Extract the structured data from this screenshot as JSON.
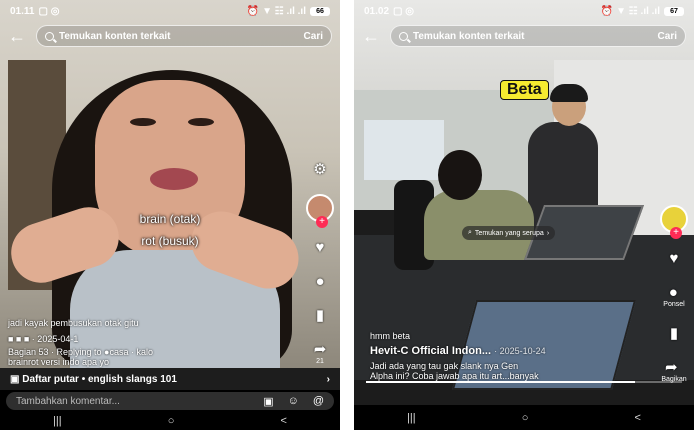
{
  "left": {
    "status_time": "01.11",
    "status_left_icons": "▢ ◎",
    "status_right_icons": "⏰ ▼ ☷ .ıl .ıl",
    "battery": "66",
    "search_placeholder": "Temukan konten terkait",
    "search_button": "Cari",
    "caption_1": "brain (otak)",
    "caption_2": "rot (busuk)",
    "caption_3": "jadi kayak pembusukan otak gitu",
    "meta_line": "■ ■ ■ · 2025-04-1",
    "reply_line_1": "Bagian 53 · Replying to ●casa · kalo",
    "reply_line_2": "brainrot versi indo apa yo",
    "like_count": "",
    "comment_count": "",
    "share_count": "21",
    "playlist_label": "Daftar putar • english slangs 101",
    "comment_placeholder": "Tambahkan komentar...",
    "icons": [
      "back-arrow",
      "search",
      "gear",
      "heart",
      "comment",
      "bookmark",
      "share",
      "picture",
      "emoji",
      "at"
    ]
  },
  "right": {
    "status_time": "01.02",
    "status_left_icons": "▢ ◎",
    "status_right_icons": "⏰ ▼ ☷ .ıl .ıl",
    "battery": "67",
    "search_placeholder": "Temukan konten terkait",
    "search_button": "Cari",
    "overlay_label": "Beta",
    "similar_pill": "Temukan yang serupa",
    "sub_label": "hmm beta",
    "author": "Hevit-C Official Indon...",
    "date": "· 2025-10-24",
    "desc_1": "Jadi ada yang tau gak slank nya Gen",
    "desc_2": "Alpha ini? Coba jawab apa itu art...banyak",
    "share_label": "Bagikan",
    "comment_label": "Ponsel",
    "progress": 0.85
  },
  "nav": {
    "recents": "|||",
    "home": "○",
    "back": "<"
  },
  "colors": {
    "tiktok_red": "#fe2c55",
    "beta_yellow": "#f5ea30"
  }
}
